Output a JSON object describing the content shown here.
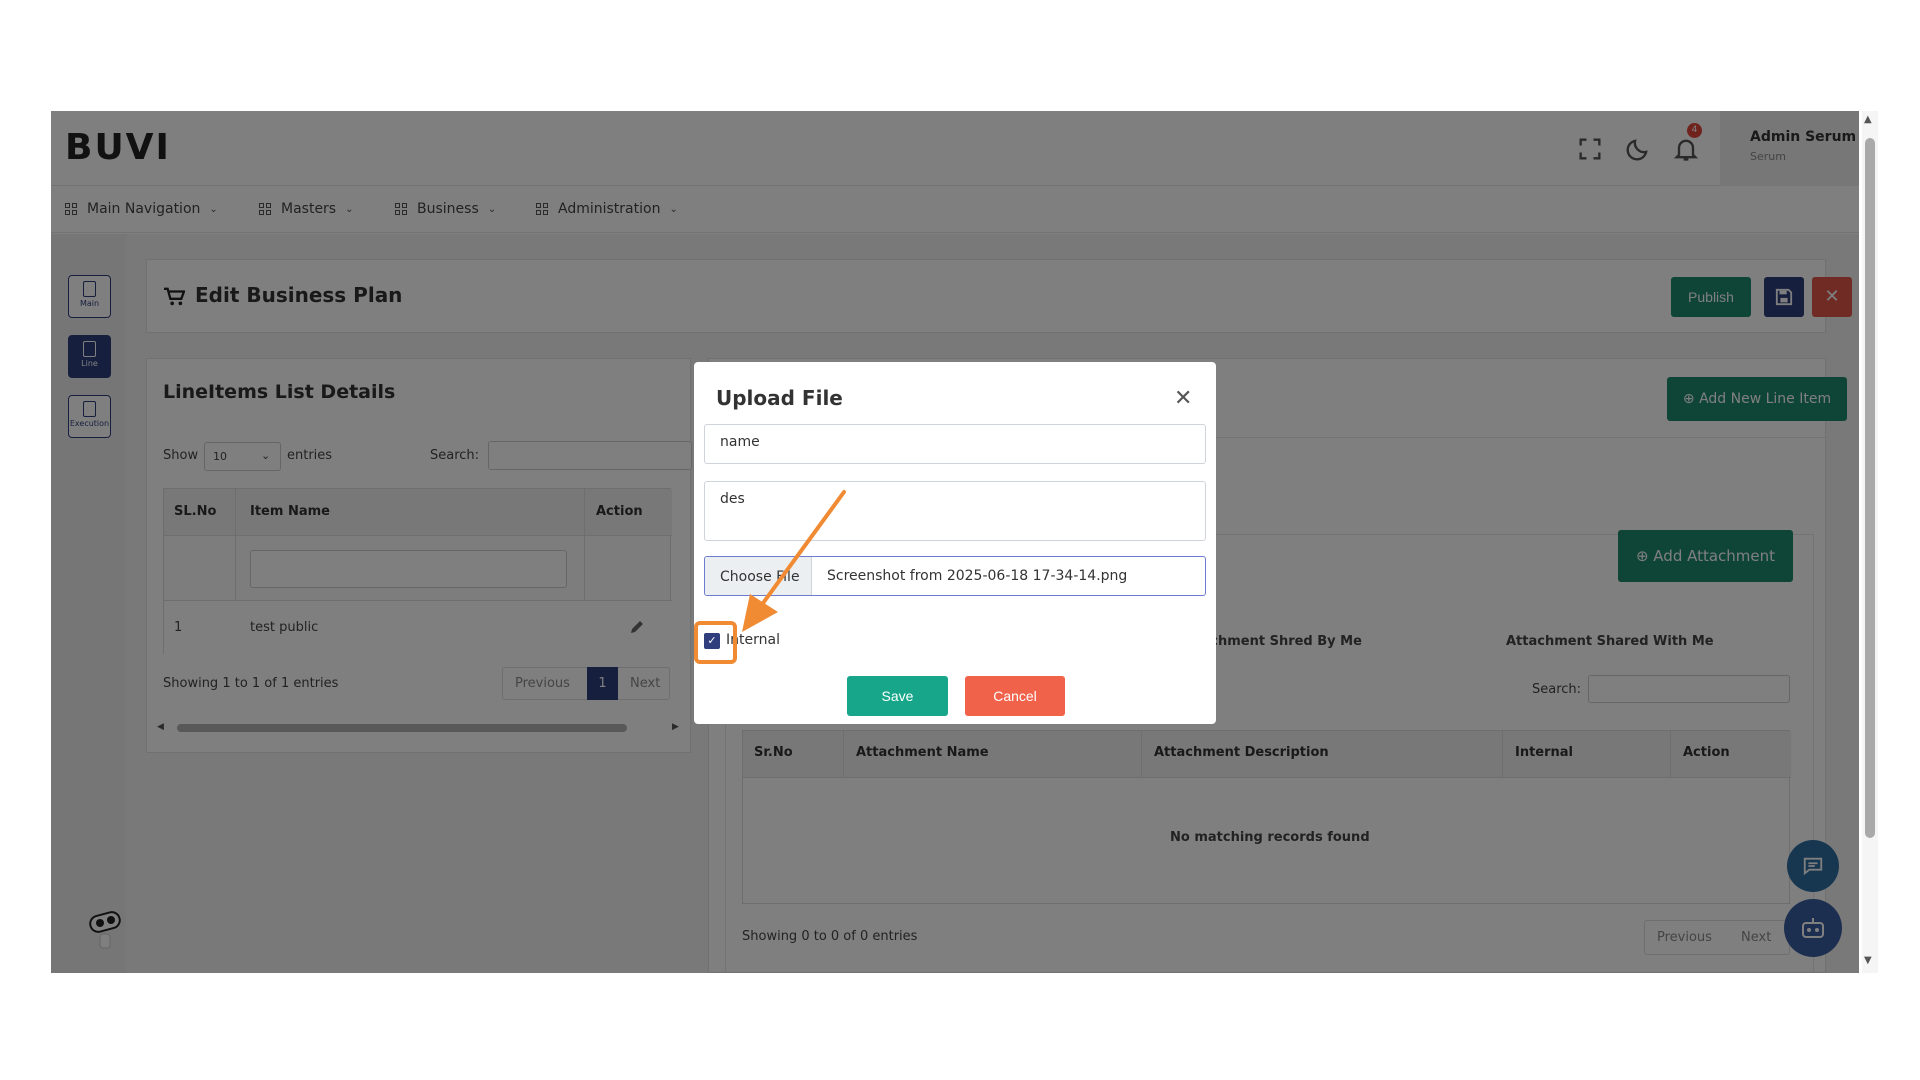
{
  "header": {
    "logo": "BUVI",
    "notification_count": "4",
    "user_name": "Admin Serum",
    "user_role": "Serum"
  },
  "nav": {
    "items": [
      {
        "label": "Main Navigation"
      },
      {
        "label": "Masters"
      },
      {
        "label": "Business"
      },
      {
        "label": "Administration"
      }
    ]
  },
  "rail": {
    "items": [
      {
        "label": "Main"
      },
      {
        "label": "Line"
      },
      {
        "label": "Execution"
      }
    ]
  },
  "page": {
    "title": "Edit Business Plan",
    "publish_label": "Publish",
    "save_icon": "save-icon",
    "close_icon": "close-icon"
  },
  "lineitems": {
    "title": "LineItems List Details",
    "show_label": "Show",
    "page_size": "10",
    "entries_label": "entries",
    "search_label": "Search:",
    "columns": [
      "SL.No",
      "Item Name",
      "Action"
    ],
    "rows": [
      {
        "sl": "1",
        "name": "test public"
      }
    ],
    "info": "Showing 1 to 1 of 1 entries",
    "prev": "Previous",
    "page": "1",
    "next": "Next"
  },
  "right": {
    "add_line_item": "Add New Line Item",
    "add_attachment": "Add Attachment",
    "tab_shared_by_me": "Attachment Shred By Me",
    "tab_shared_with_me": "Attachment Shared With Me",
    "search_label": "Search:",
    "columns": [
      "Sr.No",
      "Attachment Name",
      "Attachment Description",
      "Internal",
      "Action"
    ],
    "empty": "No matching records found",
    "info": "Showing 0 to 0 of 0 entries",
    "prev": "Previous",
    "next": "Next"
  },
  "modal": {
    "title": "Upload File",
    "name_value": "name",
    "desc_value": "des",
    "choose_file": "Choose File",
    "file_name": "Screenshot from 2025-06-18 17-34-14.png",
    "internal_label": "Internal",
    "save": "Save",
    "cancel": "Cancel"
  },
  "colors": {
    "primary_green": "#1e8a6e",
    "dark_blue": "#2f3e7c",
    "danger": "#e0574a",
    "cancel": "#f0624a",
    "annotation_orange": "#f08a33"
  }
}
